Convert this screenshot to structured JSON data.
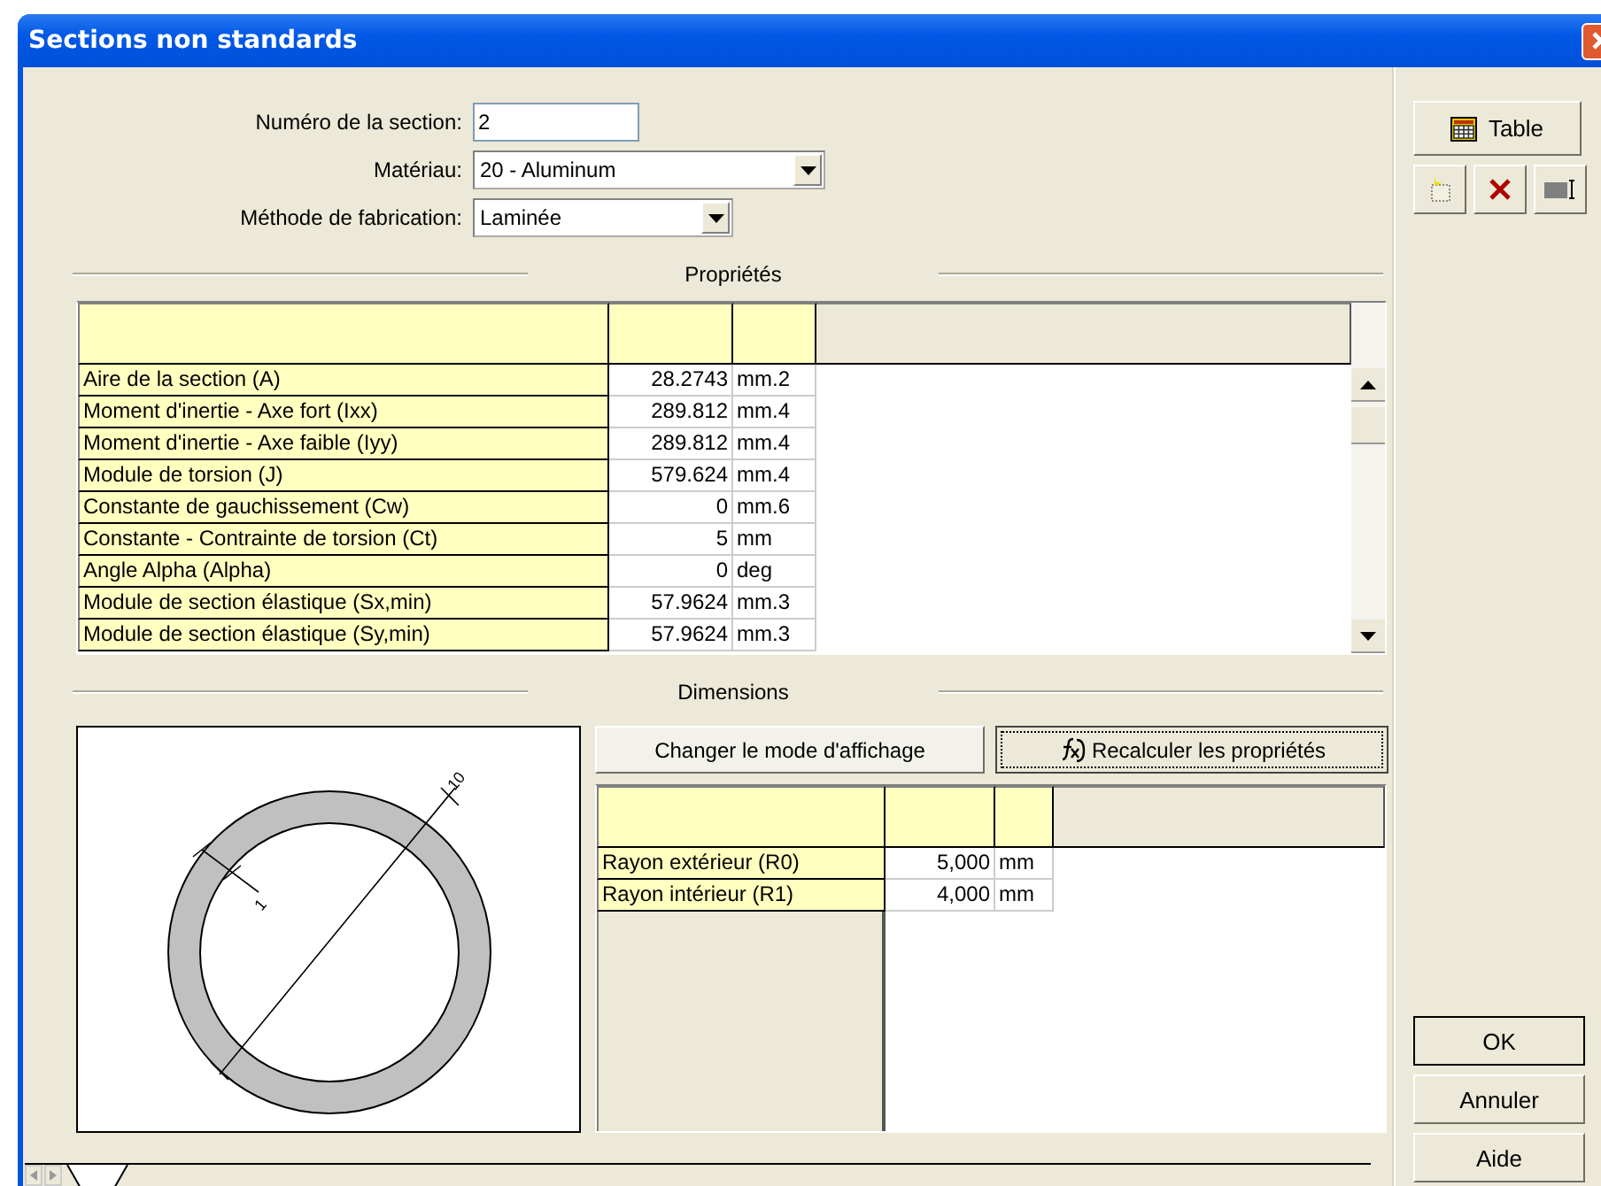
{
  "window": {
    "title": "Sections non standards"
  },
  "form": {
    "fields": [
      {
        "kind": "text",
        "label": "Numéro de la section:",
        "value": "2"
      },
      {
        "kind": "dropdown",
        "label": "Matériau:",
        "value": "20 - Aluminum"
      },
      {
        "kind": "dropdown",
        "label": "Méthode de fabrication:",
        "value": "Laminée"
      }
    ]
  },
  "properties": {
    "title": "Propriétés",
    "rows": [
      {
        "name": "Aire de la section (A)",
        "value": "28.2743",
        "unit": "mm.2"
      },
      {
        "name": "Moment d'inertie - Axe fort (Ixx)",
        "value": "289.812",
        "unit": "mm.4"
      },
      {
        "name": "Moment d'inertie - Axe faible (Iyy)",
        "value": "289.812",
        "unit": "mm.4"
      },
      {
        "name": "Module de torsion (J)",
        "value": "579.624",
        "unit": "mm.4"
      },
      {
        "name": "Constante de gauchissement (Cw)",
        "value": "0",
        "unit": "mm.6"
      },
      {
        "name": "Constante - Contrainte de torsion (Ct)",
        "value": "5",
        "unit": "mm"
      },
      {
        "name": "Angle Alpha (Alpha)",
        "value": "0",
        "unit": "deg"
      },
      {
        "name": "Module de section élastique (Sx,min)",
        "value": "57.9624",
        "unit": "mm.3"
      },
      {
        "name": "Module de section élastique (Sy,min)",
        "value": "57.9624",
        "unit": "mm.3"
      }
    ]
  },
  "dimensions": {
    "title": "Dimensions",
    "buttons": [
      {
        "kind": "plain",
        "label": "Changer le mode d'affichage"
      },
      {
        "kind": "formula",
        "label": "Recalculer les propriétés"
      }
    ],
    "drawing": {
      "diameter_label": "10",
      "thickness_label": "1"
    },
    "rows": [
      {
        "name": "Rayon extérieur (R0)",
        "value": "5,000",
        "unit": "mm"
      },
      {
        "name": "Rayon intérieur (R1)",
        "value": "4,000",
        "unit": "mm"
      }
    ]
  },
  "side": {
    "table_button": "Table",
    "dialog_buttons": [
      "OK",
      "Annuler",
      "Aide"
    ]
  }
}
